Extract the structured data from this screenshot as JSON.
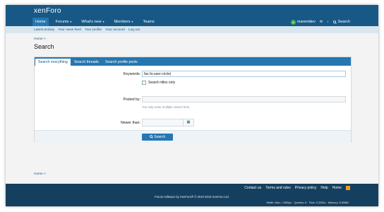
{
  "header": {
    "logo": "xenForo"
  },
  "nav": {
    "items": [
      {
        "label": "Home"
      },
      {
        "label": "Forums",
        "caret": "▾"
      },
      {
        "label": "What's new",
        "caret": "▾"
      },
      {
        "label": "Members",
        "caret": "▾"
      },
      {
        "label": "Teams"
      }
    ],
    "user": {
      "name": "marentdev",
      "initial": "m"
    },
    "search_label": "Search"
  },
  "subnav": {
    "items": [
      "Latest activity",
      "Your news feed",
      "Your profile",
      "Your account",
      "Log out"
    ]
  },
  "breadcrumb": {
    "top": "Home  >",
    "bottom": "Home  >"
  },
  "page": {
    "title": "Search"
  },
  "tabs": [
    "Search everything",
    "Search threads",
    "Search profile posts"
  ],
  "form": {
    "keywords_label": "Keywords:",
    "keywords_value": "fas fa-user-circle",
    "titles_only_label": "Search titles only",
    "posted_by_label": "Posted by:",
    "posted_by_hint": "You may enter multiple names here.",
    "newer_than_label": "Newer than:",
    "search_button": "Search"
  },
  "footer": {
    "links": [
      "Contact us",
      "Terms and rules",
      "Privacy policy",
      "Help",
      "Home"
    ],
    "copyright": "Forum software by XenForo® © 2010-2019 XenForo Ltd.",
    "stats": "Width: Max > 1500px · Queries: 8 · Time: 0.2281s · Memory: 8.50MB ·"
  },
  "colors": {
    "brand": "#185886",
    "accent": "#2577b1",
    "footer": "#153f5f"
  }
}
